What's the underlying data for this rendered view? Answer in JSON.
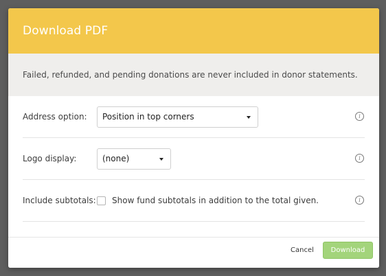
{
  "dialog": {
    "title": "Download PDF",
    "notice": "Failed, refunded, and pending donations are never included in donor statements."
  },
  "form": {
    "address_option": {
      "label": "Address option:",
      "selected": "Position in top corners",
      "info_icon": "info-circle-icon"
    },
    "logo_display": {
      "label": "Logo display:",
      "selected": "(none)",
      "info_icon": "info-circle-icon"
    },
    "include_subtotals": {
      "label": "Include subtotals:",
      "checkbox_label": "Show fund subtotals in addition to the total given.",
      "checked": false,
      "info_icon": "info-circle-icon"
    }
  },
  "footer": {
    "cancel_label": "Cancel",
    "download_label": "Download"
  },
  "colors": {
    "header_bg": "#f3c74b",
    "notice_bg": "#efeeec",
    "download_bg": "#a3d47b"
  }
}
